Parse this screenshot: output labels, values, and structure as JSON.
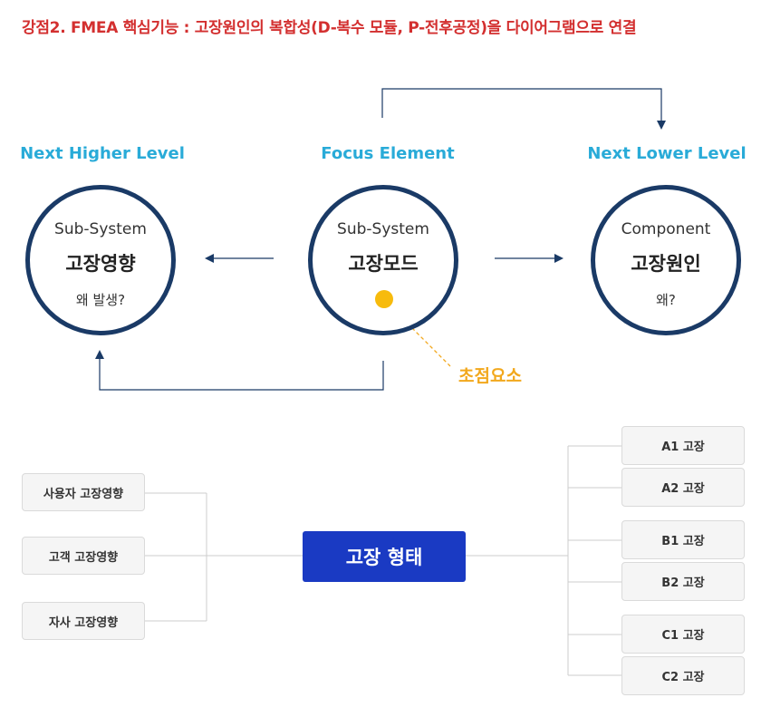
{
  "title": "강점2. FMEA 핵심기능 : 고장원인의 복합성(D-복수 모듈, P-전후공정)을 다이어그램으로 연결",
  "levels": {
    "higher": "Next Higher Level",
    "focus": "Focus Element",
    "lower": "Next Lower Level"
  },
  "circles": {
    "higher": {
      "sub": "Sub-System",
      "main": "고장영향",
      "note": "왜 발생?"
    },
    "focus": {
      "sub": "Sub-System",
      "main": "고장모드"
    },
    "lower": {
      "sub": "Component",
      "main": "고장원인",
      "note": "왜?"
    }
  },
  "focus_point_label": "초점요소",
  "effects": [
    "사용자 고장영향",
    "고객 고장영향",
    "자사 고장영향"
  ],
  "center": "고장 형태",
  "causes": [
    "A1 고장",
    "A2 고장",
    "B1 고장",
    "B2 고장",
    "C1 고장",
    "C2 고장"
  ],
  "colors": {
    "title": "#d32f2f",
    "level_label": "#29abd8",
    "circle_border": "#1a3a66",
    "focus_dot": "#f7bb0d",
    "focus_label": "#f2a81d",
    "center_box": "#1a3ac3"
  }
}
